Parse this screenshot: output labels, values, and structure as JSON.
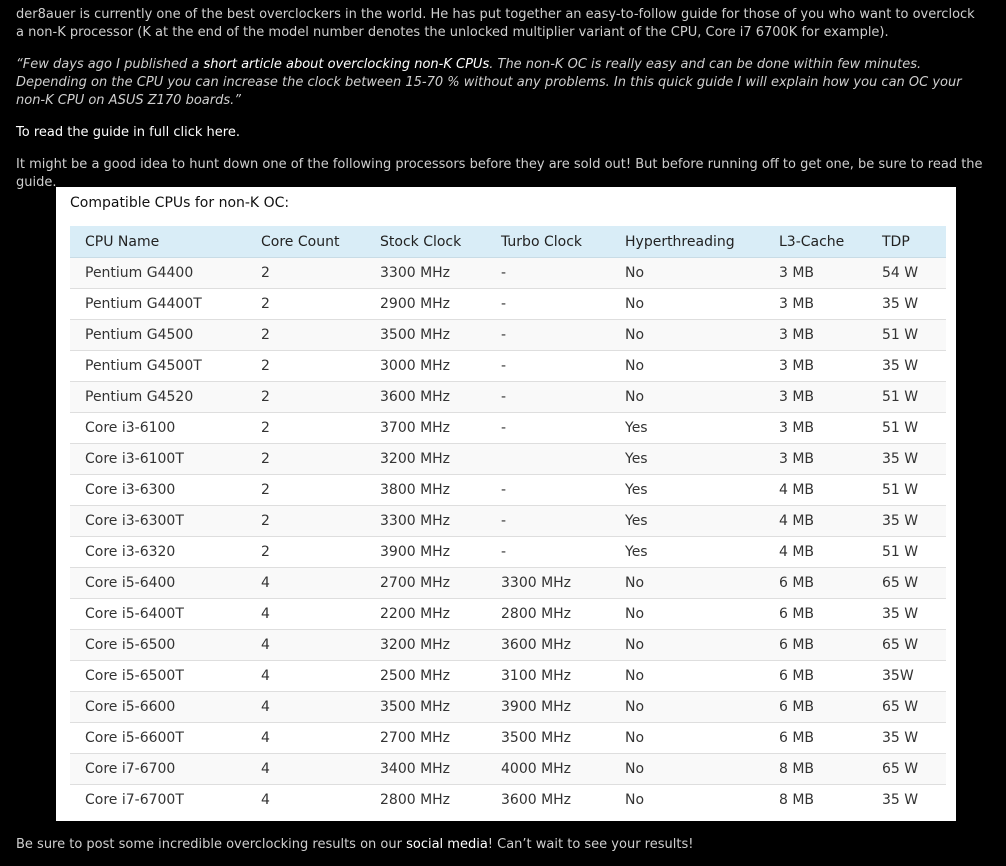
{
  "article": {
    "intro": "der8auer is currently one of the best overclockers in the world. He has put together an easy-to-follow guide for those of you who want to overclock a non-K processor (K at the end of the model number denotes the unlocked multiplier variant of the CPU, Core i7 6700K for example).",
    "quote_before": "“Few days ago I published a ",
    "quote_link": "short article about overclocking non-K CPUs",
    "quote_after": ". The non-K OC is really easy and can be done within few minutes. Depending on the CPU you can increase the clock between 15-70 % without any problems. In this quick guide I will explain how you can OC your non-K CPU on ASUS Z170 boards.”",
    "read_full_before": "To read the guide in full ",
    "read_full_link": "click here",
    "read_full_after": ".",
    "hunt": "It might be a good idea to hunt down one of the following processors before they are sold out! But before running off to get one, be sure to read the guide.",
    "outro_before": "Be sure to post some incredible overclocking results on our ",
    "outro_link": "social media",
    "outro_after": "! Can’t wait to see your results!"
  },
  "panel": {
    "title": "Compatible CPUs for non-K OC:",
    "headers": [
      "CPU Name",
      "Core Count",
      "Stock Clock",
      "Turbo Clock",
      "Hyperthreading",
      "L3-Cache",
      "TDP"
    ],
    "rows": [
      [
        "Pentium G4400",
        "2",
        "3300 MHz",
        "-",
        "No",
        "3 MB",
        "54 W"
      ],
      [
        "Pentium G4400T",
        "2",
        "2900 MHz",
        "-",
        "No",
        "3 MB",
        "35 W"
      ],
      [
        "Pentium G4500",
        "2",
        "3500 MHz",
        "-",
        "No",
        "3 MB",
        "51 W"
      ],
      [
        "Pentium G4500T",
        "2",
        "3000 MHz",
        "-",
        "No",
        "3 MB",
        "35 W"
      ],
      [
        "Pentium G4520",
        "2",
        "3600 MHz",
        "-",
        "No",
        "3 MB",
        "51 W"
      ],
      [
        "Core i3-6100",
        "2",
        "3700 MHz",
        "-",
        "Yes",
        "3 MB",
        "51 W"
      ],
      [
        "Core i3-6100T",
        "2",
        "3200 MHz",
        "",
        "Yes",
        "3 MB",
        "35 W"
      ],
      [
        "Core i3-6300",
        "2",
        "3800 MHz",
        "-",
        "Yes",
        "4 MB",
        "51 W"
      ],
      [
        "Core i3-6300T",
        "2",
        "3300 MHz",
        "-",
        "Yes",
        "4 MB",
        "35 W"
      ],
      [
        "Core i3-6320",
        "2",
        "3900 MHz",
        "-",
        "Yes",
        "4 MB",
        "51 W"
      ],
      [
        "Core i5-6400",
        "4",
        "2700 MHz",
        "3300 MHz",
        "No",
        "6 MB",
        "65 W"
      ],
      [
        "Core i5-6400T",
        "4",
        "2200 MHz",
        "2800 MHz",
        "No",
        "6 MB",
        "35 W"
      ],
      [
        "Core i5-6500",
        "4",
        "3200 MHz",
        "3600 MHz",
        "No",
        "6 MB",
        "65 W"
      ],
      [
        "Core i5-6500T",
        "4",
        "2500 MHz",
        "3100 MHz",
        "No",
        "6 MB",
        "35W"
      ],
      [
        "Core i5-6600",
        "4",
        "3500 MHz",
        "3900 MHz",
        "No",
        "6 MB",
        "65 W"
      ],
      [
        "Core i5-6600T",
        "4",
        "2700 MHz",
        "3500 MHz",
        "No",
        "6 MB",
        "35 W"
      ],
      [
        "Core i7-6700",
        "4",
        "3400 MHz",
        "4000 MHz",
        "No",
        "8 MB",
        "65 W"
      ],
      [
        "Core i7-6700T",
        "4",
        "2800 MHz",
        "3600 MHz",
        "No",
        "8 MB",
        "35 W"
      ]
    ]
  }
}
